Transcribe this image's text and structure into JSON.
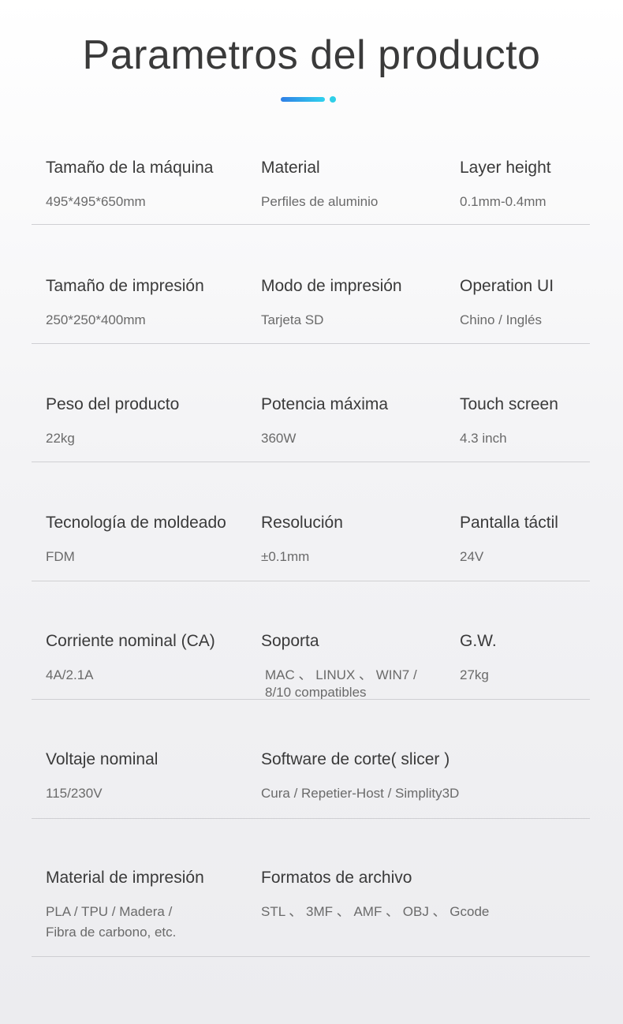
{
  "title": "Parametros del producto",
  "accent_color": "#2fcfe8",
  "rows": [
    {
      "c1": {
        "label": "Tamaño de la máquina",
        "value": "495*495*650mm"
      },
      "c2": {
        "label": "Material",
        "value": "Perfiles de aluminio"
      },
      "c3": {
        "label": "Layer height",
        "value": "0.1mm-0.4mm"
      }
    },
    {
      "c1": {
        "label": "Tamaño de impresión",
        "value": "250*250*400mm"
      },
      "c2": {
        "label": "Modo de impresión",
        "value": "Tarjeta SD"
      },
      "c3": {
        "label": "Operation UI",
        "value": "Chino / Inglés"
      }
    },
    {
      "c1": {
        "label": "Peso del producto",
        "value": "22kg"
      },
      "c2": {
        "label": "Potencia máxima",
        "value": "360W"
      },
      "c3": {
        "label": "Touch screen",
        "value": "4.3 inch"
      }
    },
    {
      "c1": {
        "label": "Tecnología de moldeado",
        "value": "FDM"
      },
      "c2": {
        "label": "Resolución",
        "value": "±0.1mm"
      },
      "c3": {
        "label": "Pantalla táctil",
        "value": "24V"
      }
    },
    {
      "c1": {
        "label": "Corriente nominal (CA)",
        "value": "4A/2.1A"
      },
      "c2": {
        "label": "Soporta",
        "value": "MAC 、 LINUX 、 WIN7 / 8/10 compatibles"
      },
      "c3": {
        "label": "G.W.",
        "value": "27kg"
      }
    },
    {
      "c1": {
        "label": "Voltaje nominal",
        "value": "115/230V"
      },
      "c2": {
        "label": "Software de corte( slicer )",
        "value": "Cura / Repetier-Host / Simplity3D"
      }
    },
    {
      "c1": {
        "label": "Material de impresión",
        "value": "PLA / TPU / Madera / Fibra de carbono, etc."
      },
      "c2": {
        "label": "Formatos de archivo",
        "value": "STL 、 3MF 、 AMF 、 OBJ 、 Gcode"
      }
    }
  ]
}
